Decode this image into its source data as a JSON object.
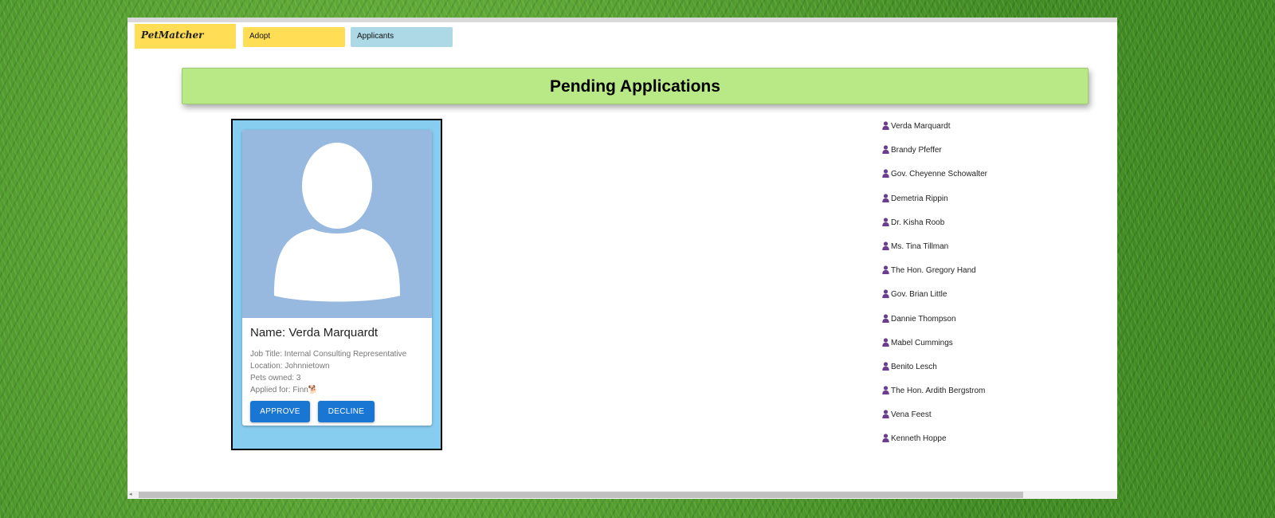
{
  "nav": {
    "brand": "PetMatcher",
    "items": [
      {
        "label": "Adopt"
      },
      {
        "label": "Applicants"
      }
    ]
  },
  "header": {
    "title": "Pending Applications"
  },
  "selected_applicant": {
    "name_label": "Name: Verda Marquardt",
    "job_title": "Job Title: Internal Consulting Representative",
    "location": "Location: Johnnietown",
    "pets_owned": "Pets owned: 3",
    "applied_for": "Applied for: Finn",
    "pet_emoji": "🐕",
    "approve_label": "APPROVE",
    "decline_label": "DECLINE"
  },
  "applicants": [
    "Verda Marquardt",
    "Brandy Pfeffer",
    "Gov. Cheyenne Schowalter",
    "Demetria Rippin",
    "Dr. Kisha Roob",
    "Ms. Tina Tillman",
    "The Hon. Gregory Hand",
    "Gov. Brian Little",
    "Dannie Thompson",
    "Mabel Cummings",
    "Benito Lesch",
    "The Hon. Ardith Bergstrom",
    "Vena Feest",
    "Kenneth Hoppe"
  ],
  "colors": {
    "brand_bg": "#ffdd55",
    "applicants_tab_bg": "#add8e6",
    "header_bg": "#b8e986",
    "card_frame_bg": "#87cdf0",
    "button_bg": "#1976d2",
    "person_icon": "#6a3d8f"
  },
  "icons": {
    "avatar": "person-silhouette-icon",
    "list_item": "person-icon",
    "scroll_left": "arrow-left-icon"
  }
}
